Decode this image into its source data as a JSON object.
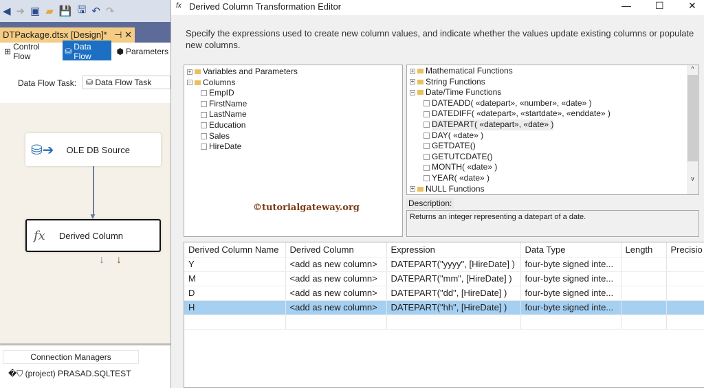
{
  "vs": {
    "doc_tab": "DTPackage.dtsx [Design]*",
    "design_tabs": [
      "Control Flow",
      "Data Flow",
      "Parameters"
    ],
    "task_label": "Data Flow Task:",
    "task_value": "Data Flow Task",
    "nodes": [
      "OLE DB Source",
      "Derived Column"
    ],
    "conn_header": "Connection Managers",
    "conn_item": "(project) PRASAD.SQLTEST"
  },
  "dialog": {
    "title": "Derived Column Transformation Editor",
    "instructions": "Specify the expressions used to create new column values, and indicate whether the values update existing columns or populate new columns.",
    "left_tree": {
      "variables": "Variables and Parameters",
      "columns": "Columns",
      "items": [
        "EmpID",
        "FirstName",
        "LastName",
        "Education",
        "Sales",
        "HireDate"
      ]
    },
    "func_tree": {
      "groups": [
        "Mathematical Functions",
        "String Functions",
        "Date/Time Functions",
        "NULL Functions"
      ],
      "datetime_items": [
        "DATEADD( «datepart», «number», «date» )",
        "DATEDIFF( «datepart», «startdate», «enddate» )",
        "DATEPART( «datepart», «date» )",
        "DAY( «date» )",
        "GETDATE()",
        "GETUTCDATE()",
        "MONTH( «date» )",
        "YEAR( «date» )"
      ],
      "selected": "DATEPART( «datepart», «date» )"
    },
    "description_label": "Description:",
    "description": "Returns an integer representing a datepart of a date.",
    "watermark": "©tutorialgateway.org",
    "grid": {
      "headers": [
        "Derived Column Name",
        "Derived Column",
        "Expression",
        "Data Type",
        "Length",
        "Precisio"
      ],
      "rows": [
        [
          "Y",
          "<add as new column>",
          "DATEPART(\"yyyy\", [HireDate]  )",
          "four-byte signed inte..."
        ],
        [
          "M",
          "<add as new column>",
          "DATEPART(\"mm\", [HireDate]  )",
          "four-byte signed inte..."
        ],
        [
          "D",
          "<add as new column>",
          "DATEPART(\"dd\", [HireDate]  )",
          "four-byte signed inte..."
        ],
        [
          "H",
          "<add as new column>",
          "DATEPART(\"hh\", [HireDate]  )",
          "four-byte signed inte..."
        ]
      ],
      "selected_row": 3
    }
  }
}
